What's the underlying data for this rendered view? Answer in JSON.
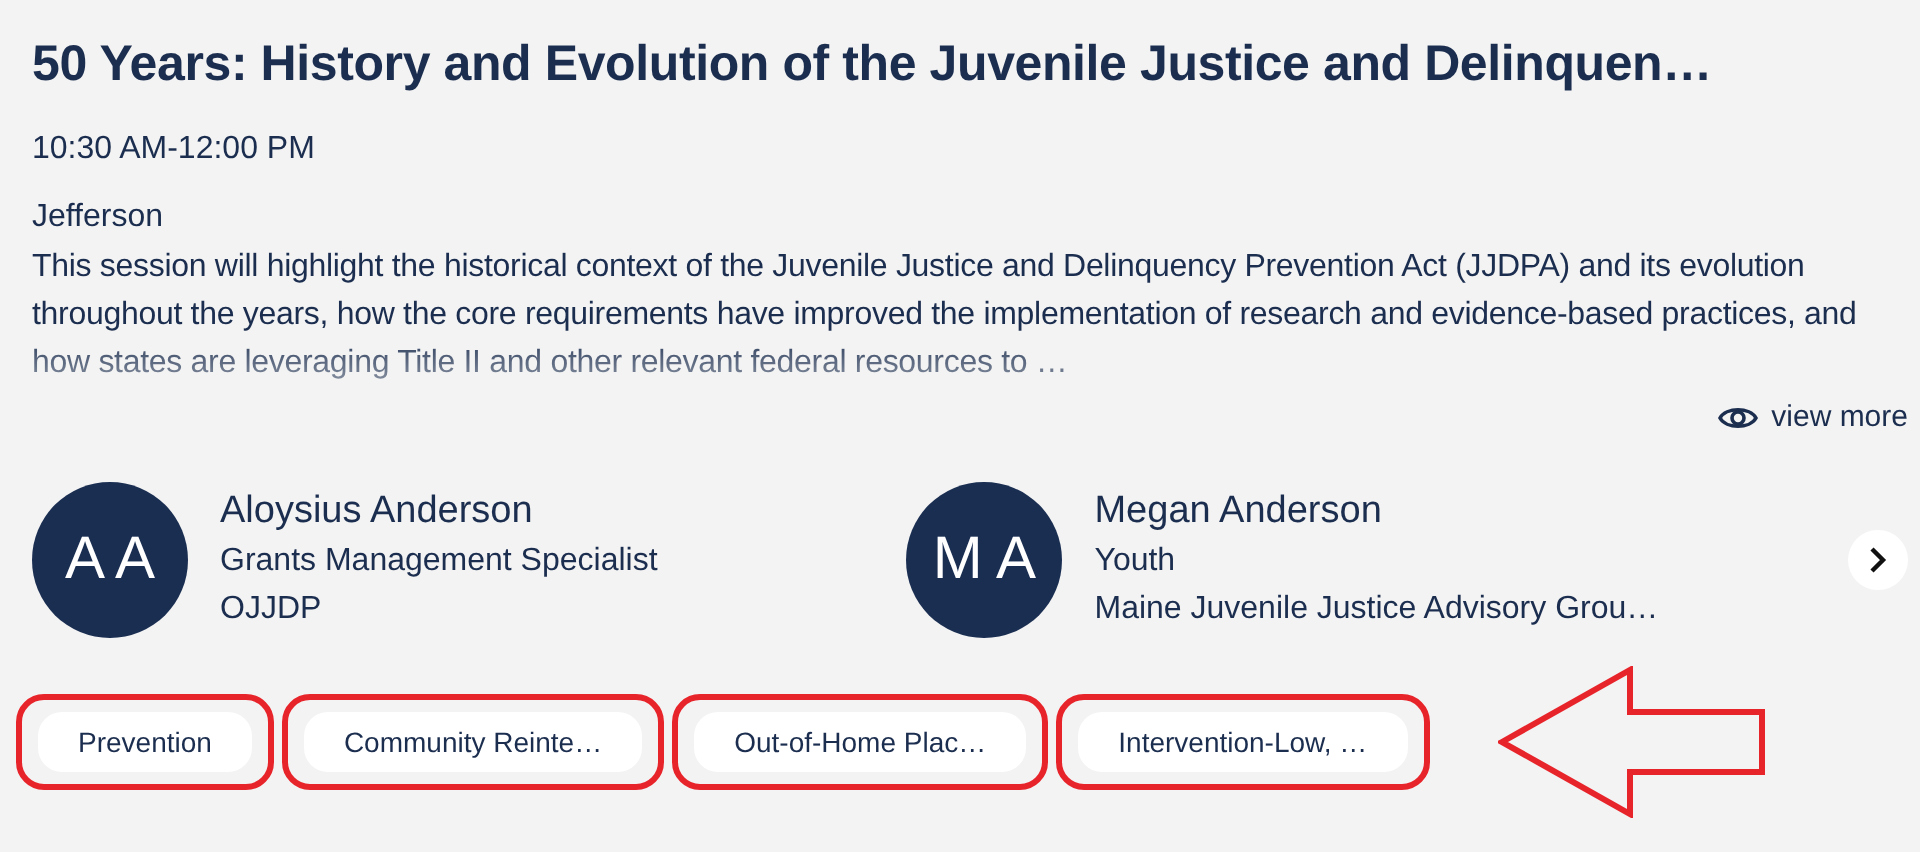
{
  "session": {
    "title": "50 Years: History and Evolution of the Juvenile Justice and Delinquen…",
    "time": "10:30 AM-12:00 PM",
    "location": "Jefferson",
    "description": "This session will highlight the historical context of the Juvenile Justice and Delinquency Prevention Act (JJDPA) and its evolution throughout the years, how the core requirements have improved the implementation of research and evidence-based practices, and how states are leveraging Title II and other relevant federal resources to …",
    "view_more": "view more"
  },
  "speakers": [
    {
      "initials": "A A",
      "name": "Aloysius Anderson",
      "role": "Grants Management Specialist",
      "org": "OJJDP"
    },
    {
      "initials": "M A",
      "name": "Megan Anderson",
      "role": "Youth",
      "org": "Maine Juvenile Justice Advisory Grou…"
    }
  ],
  "tags": [
    {
      "label": "Prevention",
      "circled": true
    },
    {
      "label": "Community Reinte…",
      "circled": true
    },
    {
      "label": "Out-of-Home Plac…",
      "circled": true
    },
    {
      "label": "Intervention-Low, …",
      "circled": true
    }
  ],
  "annotation": {
    "kind": "arrow"
  }
}
